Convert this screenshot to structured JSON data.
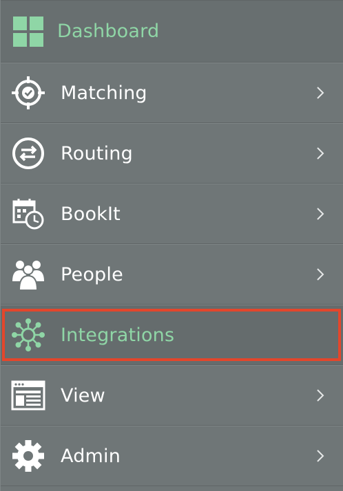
{
  "colors": {
    "background": "#6f7677",
    "accent": "#8fd6a6",
    "text": "#ffffff",
    "highlight_border": "#e4462b"
  },
  "nav": {
    "items": [
      {
        "label": "Dashboard",
        "icon": "grid-icon",
        "accent": true,
        "has_chevron": false,
        "selected": false
      },
      {
        "label": "Matching",
        "icon": "target-check-icon",
        "accent": false,
        "has_chevron": true,
        "selected": false
      },
      {
        "label": "Routing",
        "icon": "arrows-exchange-icon",
        "accent": false,
        "has_chevron": true,
        "selected": false
      },
      {
        "label": "BookIt",
        "icon": "calendar-clock-icon",
        "accent": false,
        "has_chevron": true,
        "selected": false
      },
      {
        "label": "People",
        "icon": "people-group-icon",
        "accent": false,
        "has_chevron": true,
        "selected": false
      },
      {
        "label": "Integrations",
        "icon": "network-hub-icon",
        "accent": true,
        "has_chevron": false,
        "selected": true
      },
      {
        "label": "View",
        "icon": "window-layout-icon",
        "accent": false,
        "has_chevron": true,
        "selected": false
      },
      {
        "label": "Admin",
        "icon": "gear-icon",
        "accent": false,
        "has_chevron": true,
        "selected": false
      }
    ]
  }
}
